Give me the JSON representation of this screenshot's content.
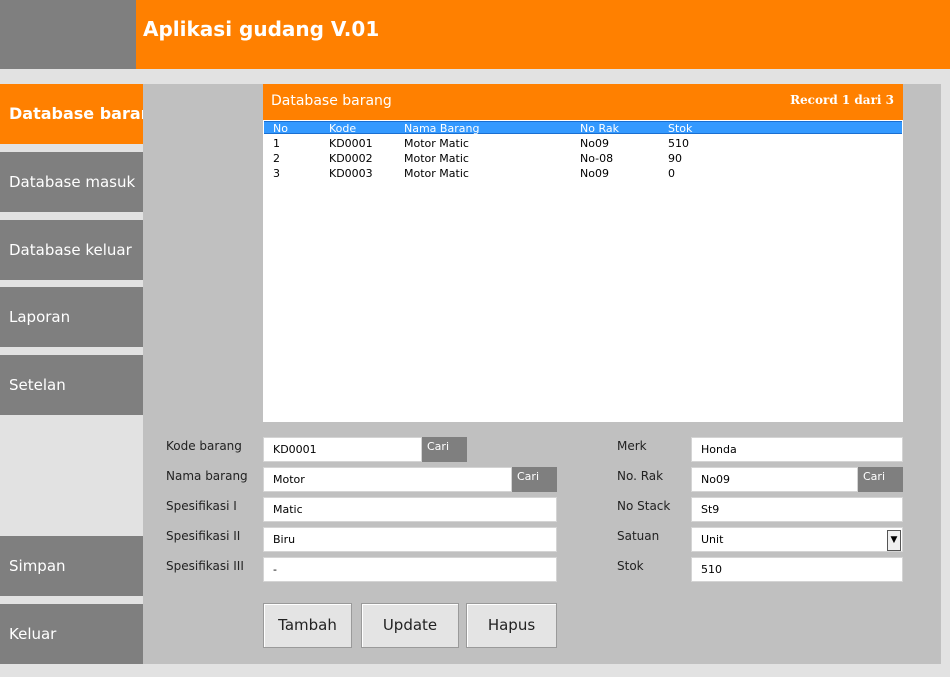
{
  "app": {
    "title": "Aplikasi gudang V.01"
  },
  "nav": {
    "items": [
      {
        "label": "Database barang"
      },
      {
        "label": "Database masuk"
      },
      {
        "label": "Database keluar"
      },
      {
        "label": "Laporan"
      },
      {
        "label": "Setelan"
      }
    ],
    "simpan": "Simpan",
    "keluar": "Keluar"
  },
  "table": {
    "title": "Database barang",
    "record_info": "Record 1 dari 3",
    "columns": [
      "No",
      "Kode",
      "Nama Barang",
      "No Rak",
      "Stok"
    ],
    "rows": [
      [
        "1",
        "KD0001",
        "Motor Matic",
        "No09",
        "510"
      ],
      [
        "2",
        "KD0002",
        "Motor Matic",
        "No-08",
        "90"
      ],
      [
        "3",
        "KD0003",
        "Motor Matic",
        "No09",
        "0"
      ]
    ]
  },
  "form": {
    "kode_barang": {
      "label": "Kode barang",
      "value": "KD0001",
      "button": "Cari"
    },
    "nama_barang": {
      "label": "Nama barang",
      "value": "Motor",
      "button": "Cari"
    },
    "spesifikasi1": {
      "label": "Spesifikasi I",
      "value": "Matic"
    },
    "spesifikasi2": {
      "label": "Spesifikasi II",
      "value": "Biru"
    },
    "spesifikasi3": {
      "label": "Spesifikasi III",
      "value": "-"
    },
    "merk": {
      "label": "Merk",
      "value": "Honda"
    },
    "no_rak": {
      "label": "No. Rak",
      "value": "No09",
      "button": "Cari"
    },
    "no_stack": {
      "label": "No Stack",
      "value": "St9"
    },
    "satuan": {
      "label": "Satuan",
      "value": "Unit"
    },
    "stok": {
      "label": "Stok",
      "value": "510"
    }
  },
  "buttons": {
    "tambah": "Tambah",
    "update": "Update",
    "hapus": "Hapus"
  },
  "colors": {
    "accent": "#ff8000",
    "nav_gray": "#7f7f7f",
    "panel": "#c0c0c0",
    "selection": "#3399ff"
  },
  "icons": {
    "dropdown": "chevron-down-icon"
  }
}
